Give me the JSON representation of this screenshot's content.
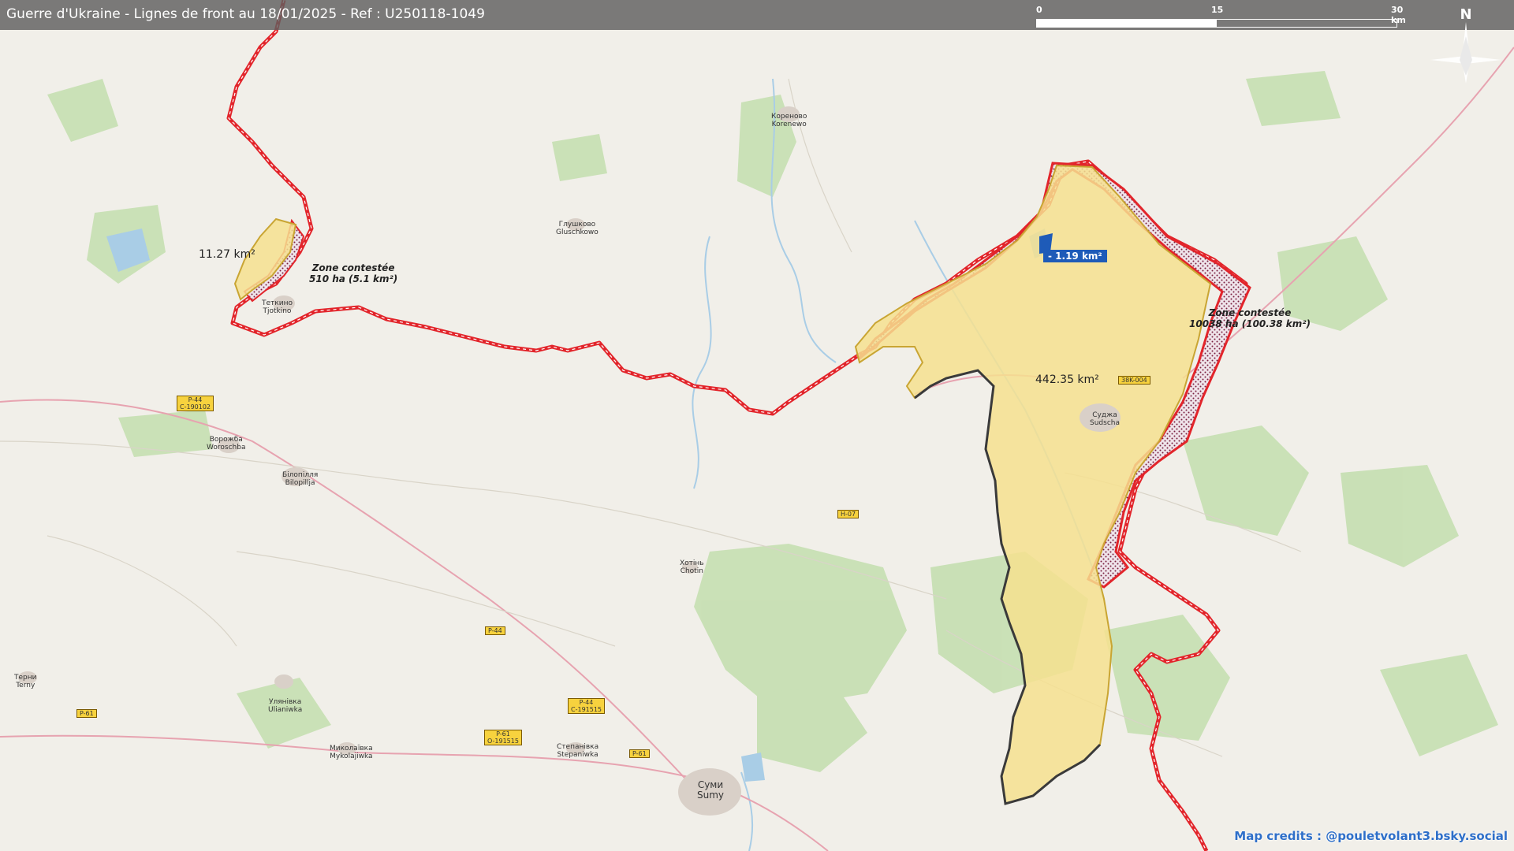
{
  "header": {
    "title": "Guerre d'Ukraine - Lignes de front au 18/01/2025 - Ref : U250118-1049",
    "scale_labels": [
      "0",
      "15",
      "30 km"
    ],
    "north_label": "N"
  },
  "areas": {
    "sudzha_area": "442.35 km²",
    "tetkino_area": "11.27 km²",
    "loss_badge": "- 1.19 km²",
    "contested_east_line1": "Zone contestée",
    "contested_east_line2": "10038 ha (100.38 km²)",
    "contested_west_line1": "Zone contestée",
    "contested_west_line2": "510 ha (5.1 km²)"
  },
  "places": [
    {
      "name": "Кореново",
      "name2": "Korenewo"
    },
    {
      "name": "Глушково",
      "name2": "Gluschkowo"
    },
    {
      "name": "Теткино",
      "name2": "Tjotkino"
    },
    {
      "name": "Суджа",
      "name2": "Sudscha"
    },
    {
      "name": "Ворожба",
      "name2": "Woroschba"
    },
    {
      "name": "Білопілля",
      "name2": "Bilopillja"
    },
    {
      "name": "Хотінь",
      "name2": "Chotin"
    },
    {
      "name": "Терни",
      "name2": "Terny"
    },
    {
      "name": "Улянівка",
      "name2": "Ulianiwka"
    },
    {
      "name": "Миколаївка",
      "name2": "Mykolajiwka"
    },
    {
      "name": "Степанівка",
      "name2": "Stepaniwka"
    },
    {
      "name": "Суми",
      "name2": "Sumy"
    }
  ],
  "roads": {
    "p44_a": "P-44",
    "p44_a_sub": "C-190102",
    "p44_b": "P-44",
    "p44_c": "P-44",
    "p44_c_sub": "C-191515",
    "p61_a": "P-61",
    "p61_b": "P-61",
    "p61_b_sub": "O-191515",
    "p61_c": "P-61",
    "h07": "H-07",
    "r38": "38K-004"
  },
  "colors": {
    "occupied_fill": "#f6e08f",
    "contested_hatch": "#7a2040",
    "border_red": "#e2252b",
    "front_line": "#3a3a3a",
    "loss_badge": "#1e5bb8",
    "forest": "#c5dfb1",
    "water": "#a9cde6"
  },
  "credits": "Map credits : @pouletvolant3.bsky.social"
}
